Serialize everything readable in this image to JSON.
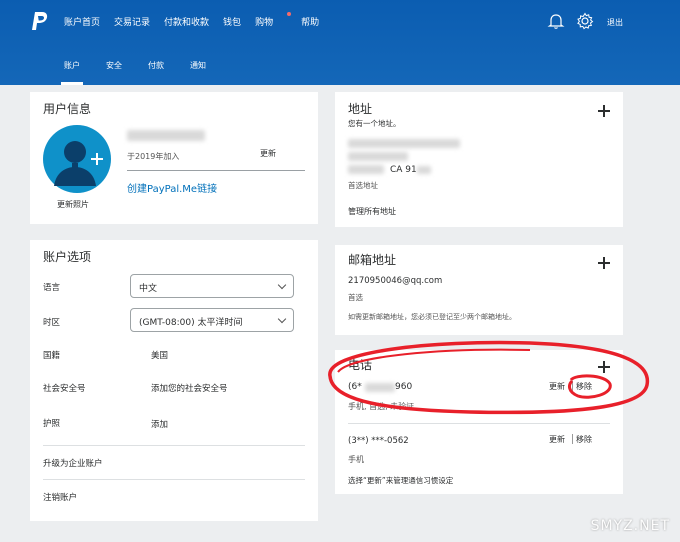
{
  "nav": {
    "items": [
      "账户首页",
      "交易记录",
      "付款和收款",
      "钱包",
      "购物",
      "帮助"
    ],
    "logout": "退出"
  },
  "subnav": {
    "items": [
      "账户",
      "安全",
      "付款",
      "通知"
    ]
  },
  "user_info": {
    "title": "用户信息",
    "joined": "于2019年加入",
    "update": "更新",
    "paypal_me": "创建PayPal.Me链接",
    "update_photo": "更新照片"
  },
  "account_options": {
    "title": "账户选项",
    "language_label": "语言",
    "language_value": "中文",
    "timezone_label": "时区",
    "timezone_value": "(GMT-08:00) 太平洋时间",
    "country_label": "国籍",
    "country_value": "美国",
    "ssn_label": "社会安全号",
    "ssn_link": "添加您的社会安全号",
    "passport_label": "护照",
    "passport_link": "添加",
    "upgrade": "升级为企业账户",
    "close": "注销账户"
  },
  "address": {
    "title": "地址",
    "count": "您有一个地址。",
    "partial": "CA 91",
    "primary": "首选地址",
    "manage": "管理所有地址"
  },
  "email": {
    "title": "邮箱地址",
    "value": "2170950046@qq.com",
    "primary": "首选",
    "note": "如需更新邮箱地址，您必须已登记至少两个邮箱地址。"
  },
  "phone": {
    "title": "电话",
    "phone1_prefix": "(6*",
    "phone1_suffix": "960",
    "phone1_meta": "手机, 首选, 未验证",
    "phone1_update": "更新",
    "phone1_remove": "移除",
    "phone2": "(3**) ***-0562",
    "phone2_meta": "手机",
    "phone2_update": "更新",
    "phone2_remove": "移除",
    "note": "选择“更新”来管理通信习惯设定"
  },
  "watermark": "SMYZ.NET",
  "colors": {
    "brand": "#0d5fb3",
    "link": "#0070ba",
    "annotation": "#e8202a"
  }
}
